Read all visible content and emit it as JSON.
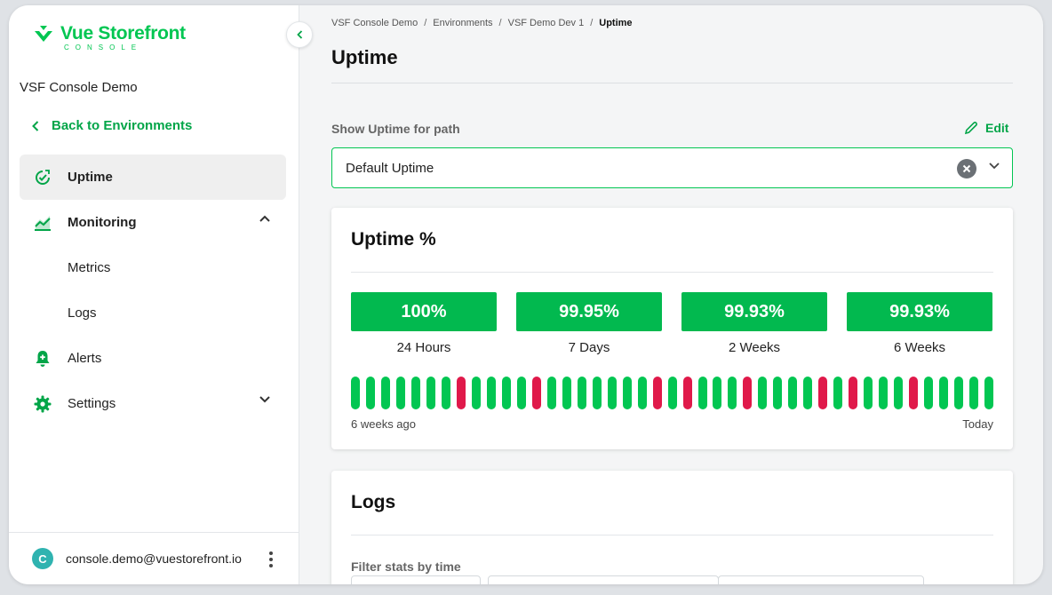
{
  "sidebar": {
    "logo_name": "Vue Storefront",
    "logo_sub": "CONSOLE",
    "org_name": "VSF Console Demo",
    "back_label": "Back to Environments",
    "items": [
      {
        "label": "Uptime",
        "icon": "uptime-check-icon"
      },
      {
        "label": "Monitoring",
        "icon": "chart-area-icon"
      },
      {
        "label": "Metrics"
      },
      {
        "label": "Logs"
      },
      {
        "label": "Alerts",
        "icon": "bell-plus-icon"
      },
      {
        "label": "Settings",
        "icon": "gear-icon"
      }
    ],
    "user_avatar": "C",
    "user_email": "console.demo@vuestorefront.io"
  },
  "breadcrumb": [
    "VSF Console Demo",
    "Environments",
    "VSF Demo Dev 1",
    "Uptime"
  ],
  "page_title": "Uptime",
  "path_selector": {
    "label": "Show Uptime for path",
    "edit_label": "Edit",
    "selected": "Default Uptime"
  },
  "uptime_card": {
    "title": "Uptime %",
    "stats": [
      {
        "value": "100%",
        "period": "24 Hours"
      },
      {
        "value": "99.95%",
        "period": "7 Days"
      },
      {
        "value": "99.93%",
        "period": "2 Weeks"
      },
      {
        "value": "99.93%",
        "period": "6 Weeks"
      }
    ],
    "history": [
      "up",
      "up",
      "up",
      "up",
      "up",
      "up",
      "up",
      "down",
      "up",
      "up",
      "up",
      "up",
      "down",
      "up",
      "up",
      "up",
      "up",
      "up",
      "up",
      "up",
      "down",
      "up",
      "down",
      "up",
      "up",
      "up",
      "down",
      "up",
      "up",
      "up",
      "up",
      "down",
      "up",
      "down",
      "up",
      "up",
      "up",
      "down",
      "up",
      "up",
      "up",
      "up",
      "up"
    ],
    "range_start": "6 weeks ago",
    "range_end": "Today"
  },
  "logs_card": {
    "title": "Logs",
    "filter_label": "Filter stats by time"
  },
  "colors": {
    "brand": "#02c652",
    "up": "#02c652",
    "down": "#e0194a"
  }
}
